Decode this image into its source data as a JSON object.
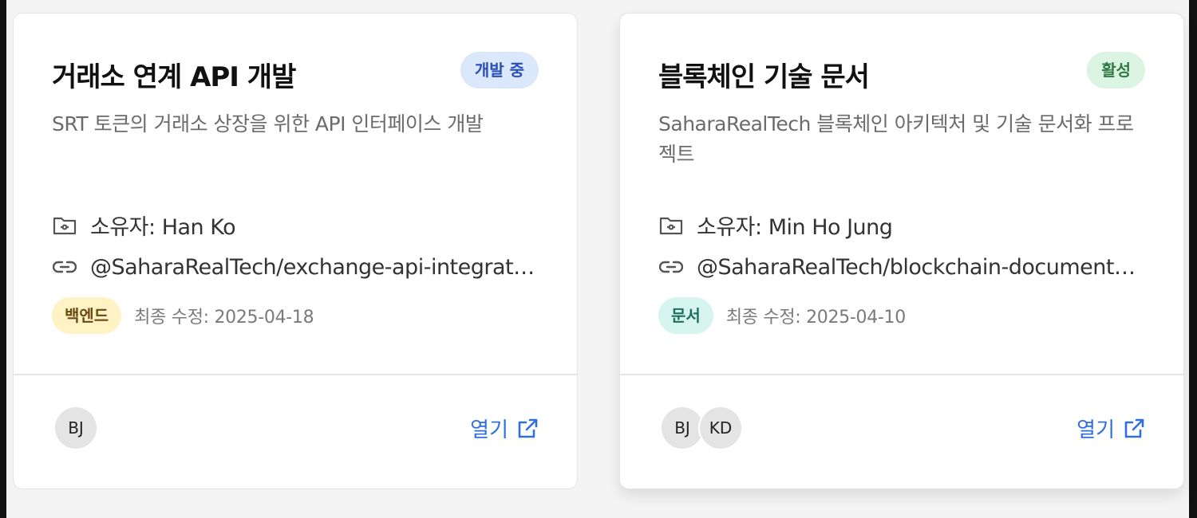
{
  "projects": [
    {
      "title": "거래소 연계 API 개발",
      "status": "개발 중",
      "description": "SRT 토큰의 거래소 상장을 위한 API 인터페이스 개발",
      "owner": "소유자: Han Ko",
      "repo": "@SaharaRealTech/exchange-api-integration",
      "tag": "백엔드",
      "modified": "최종 수정: 2025-04-18",
      "avatars": [
        "BJ"
      ],
      "open_label": "열기",
      "colors": {
        "status_bg": "#dbe7fb",
        "status_fg": "#2a4fb5",
        "tag_bg": "#fdf3c4",
        "tag_fg": "#6b4a14"
      }
    },
    {
      "title": "블록체인 기술 문서",
      "status": "활성",
      "description": "SaharaRealTech 블록체인 아키텍처 및 기술 문서화 프로젝트",
      "owner": "소유자: Min Ho Jung",
      "repo": "@SaharaRealTech/blockchain-documentation",
      "tag": "문서",
      "modified": "최종 수정: 2025-04-10",
      "avatars": [
        "BJ",
        "KD"
      ],
      "open_label": "열기",
      "colors": {
        "status_bg": "#dcf5e3",
        "status_fg": "#2f7a45",
        "tag_bg": "#d6f5ee",
        "tag_fg": "#1f6f5c"
      }
    }
  ],
  "icons": {
    "owner": "folder-icon",
    "repo": "link-icon",
    "open": "external-link-icon"
  },
  "accent_color": "#2f6fe0"
}
